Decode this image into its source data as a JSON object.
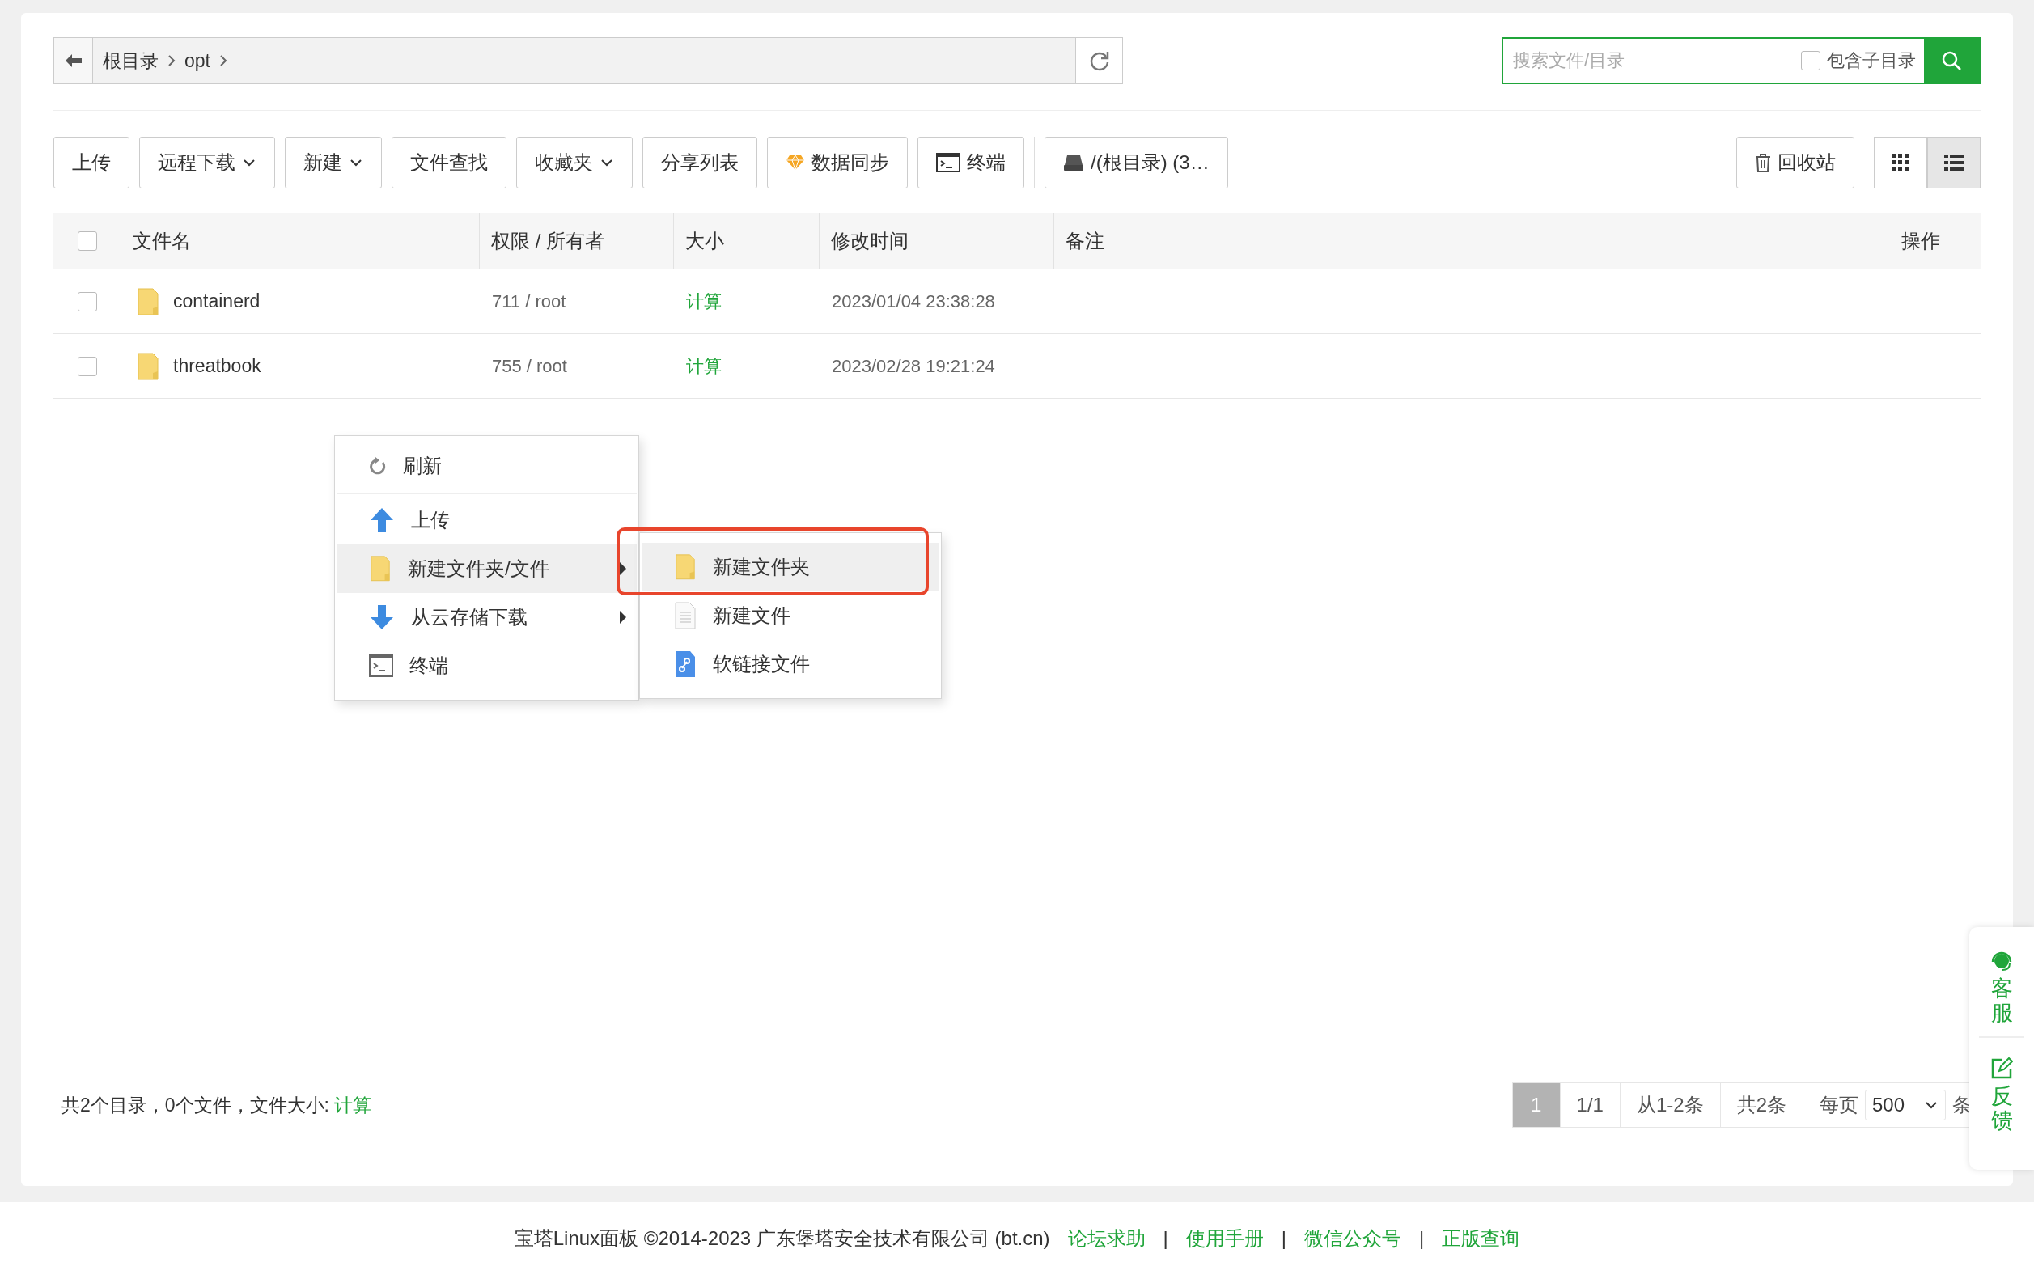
{
  "breadcrumb": {
    "segments": [
      "根目录",
      "opt"
    ]
  },
  "search": {
    "placeholder": "搜索文件/目录",
    "include_subdirs": {
      "label": "包含子目录",
      "checked": false
    }
  },
  "toolbar": [
    {
      "label": "上传",
      "kind": "plain"
    },
    {
      "label": "远程下载",
      "kind": "dropdown"
    },
    {
      "label": "新建",
      "kind": "dropdown"
    },
    {
      "label": "文件查找",
      "kind": "plain"
    },
    {
      "label": "收藏夹",
      "kind": "dropdown"
    },
    {
      "label": "分享列表",
      "kind": "plain"
    },
    {
      "label": "数据同步",
      "kind": "gem"
    },
    {
      "label": "终端",
      "kind": "terminal"
    },
    {
      "label": "/(根目录) (3…",
      "kind": "disk"
    }
  ],
  "recycle": {
    "label": "回收站"
  },
  "views": [
    {
      "kind": "grid",
      "selected": false
    },
    {
      "kind": "list",
      "selected": true
    }
  ],
  "table": {
    "select_all": false,
    "columns": [
      "文件名",
      "权限 / 所有者",
      "大小",
      "修改时间",
      "备注",
      "操作"
    ],
    "rows": [
      {
        "name": "containerd",
        "permission": "711 / root",
        "size": "计算",
        "modified": "2023/01/04 23:38:28",
        "checked": false
      },
      {
        "name": "threatbook",
        "permission": "755 / root",
        "size": "计算",
        "modified": "2023/02/28 19:21:24",
        "checked": false
      }
    ]
  },
  "context_menu": {
    "items": [
      {
        "label": "刷新",
        "kind": "refresh",
        "submenu": false,
        "selected": false
      },
      {
        "label": "上传",
        "kind": "upload",
        "submenu": false,
        "selected": false
      },
      {
        "label": "新建文件夹/文件",
        "kind": "folder",
        "submenu": true,
        "selected": true
      },
      {
        "label": "从云存储下载",
        "kind": "download",
        "submenu": true,
        "selected": false
      },
      {
        "label": "终端",
        "kind": "terminal",
        "submenu": false,
        "selected": false
      }
    ],
    "submenu": [
      {
        "label": "新建文件夹",
        "kind": "folder",
        "selected": true,
        "highlighted": true
      },
      {
        "label": "新建文件",
        "kind": "file",
        "selected": false,
        "highlighted": false
      },
      {
        "label": "软链接文件",
        "kind": "link",
        "selected": false,
        "highlighted": false
      }
    ]
  },
  "summary": {
    "text": "共2个目录，0个文件，文件大小:",
    "link": "计算"
  },
  "pagination": {
    "pages": [
      {
        "label": "1",
        "selected": true
      }
    ],
    "page_info": "1/1",
    "range": "从1-2条",
    "total": "共2条",
    "per_page_label": "每页",
    "per_page": "500",
    "unit": "条"
  },
  "side_widget": [
    {
      "kind": "service",
      "label": "客服"
    },
    {
      "kind": "feedback",
      "label": "反馈"
    }
  ],
  "footer": {
    "copyright": "宝塔Linux面板 ©2014-2023 广东堡塔安全技术有限公司 (bt.cn)",
    "separator": "|",
    "links": [
      "论坛求助",
      "使用手册",
      "微信公众号",
      "正版查询"
    ]
  }
}
